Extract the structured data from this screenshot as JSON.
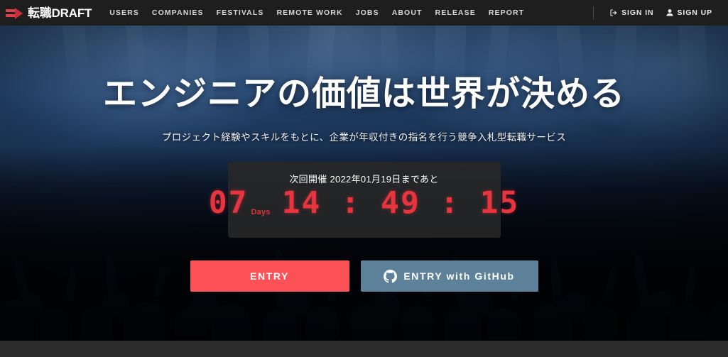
{
  "header": {
    "logo": {
      "text": "転職DRAFT",
      "mark_icon": "draft-arrow-logo-icon",
      "accent_color": "#e04048"
    },
    "nav": [
      {
        "label": "USERS"
      },
      {
        "label": "COMPANIES"
      },
      {
        "label": "FESTIVALS"
      },
      {
        "label": "REMOTE WORK"
      },
      {
        "label": "JOBS"
      },
      {
        "label": "ABOUT"
      },
      {
        "label": "RELEASE"
      },
      {
        "label": "REPORT"
      }
    ],
    "auth": {
      "sign_in": {
        "label": "SIGN IN",
        "icon": "sign-in-icon"
      },
      "sign_up": {
        "label": "SIGN UP",
        "icon": "user-icon"
      }
    },
    "background_color": "#1e1e1e"
  },
  "hero": {
    "title": "エンジニアの価値は世界が決める",
    "subtitle": "プロジェクト経験やスキルをもとに、企業が年収付きの指名を行う競争入札型転職サービス",
    "background_description": "concert-crowd-photo",
    "countdown": {
      "label": "次回開催 2022年01月19日まであと",
      "days": "07",
      "days_unit": "Days",
      "time": "14 : 49 : 15",
      "hours": "14",
      "minutes": "49",
      "seconds": "15",
      "digit_color": "#e8343f",
      "panel_color": "rgba(40,40,40,0.88)"
    },
    "buttons": {
      "entry": {
        "label": "ENTRY",
        "color": "#fb5157"
      },
      "github": {
        "label": "ENTRY with GitHub",
        "icon": "github-icon",
        "color": "#5e819a"
      }
    }
  },
  "page": {
    "below_fold_color": "#2b2b2b"
  }
}
